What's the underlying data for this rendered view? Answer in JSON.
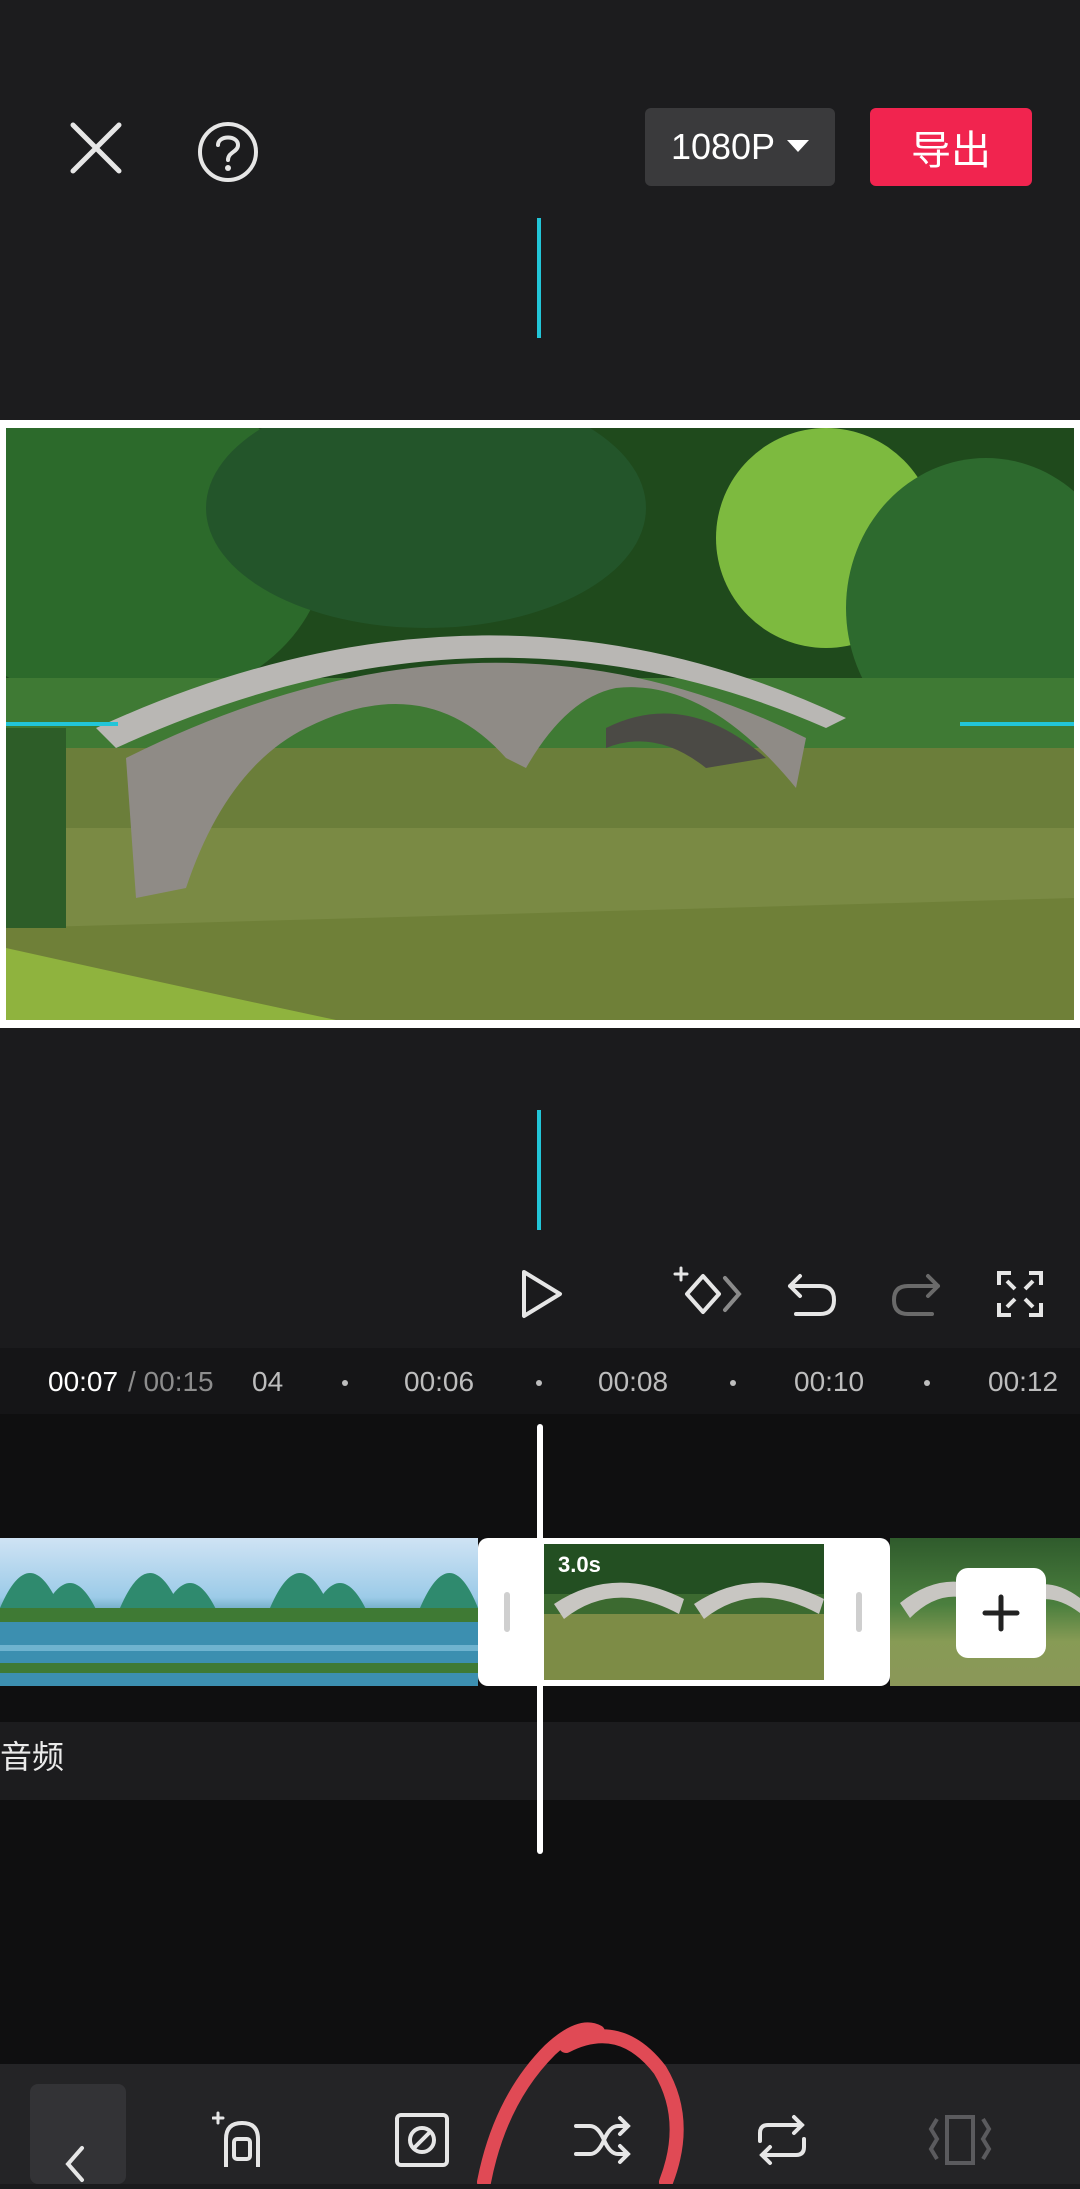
{
  "header": {
    "resolution": "1080P",
    "export_label": "导出"
  },
  "ruler": {
    "current_time": "00:07",
    "total_time": "/ 00:15",
    "ticks": [
      "04",
      "00:06",
      "00:08",
      "00:10",
      "00:12"
    ]
  },
  "timeline": {
    "selected_clip_duration": "3.0s",
    "audio_label": "音频"
  },
  "colors": {
    "accent_guide": "#22c5d8",
    "export_red": "#f1244f",
    "annotation_red": "#e04a55"
  }
}
